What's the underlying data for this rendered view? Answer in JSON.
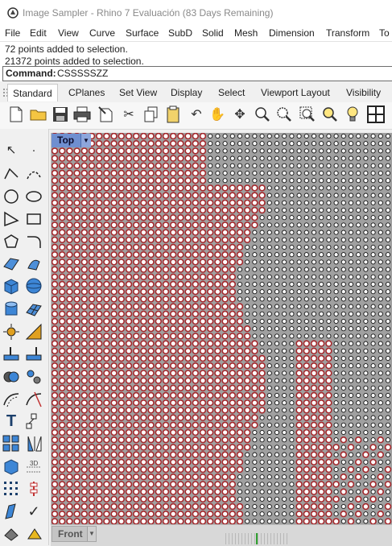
{
  "window": {
    "title": "Image Sampler - Rhino 7 Evaluación (83 Days Remaining)"
  },
  "menubar": {
    "items": [
      "File",
      "Edit",
      "View",
      "Curve",
      "Surface",
      "SubD",
      "Solid",
      "Mesh",
      "Dimension",
      "Transform",
      "To"
    ]
  },
  "history": {
    "lines": [
      "72 points added to selection.",
      "21372 points added to selection."
    ]
  },
  "command": {
    "label": "Command:",
    "value": "CSSSSSZZ"
  },
  "tabs": [
    "Standard",
    "CPlanes",
    "Set View",
    "Display",
    "Select",
    "Viewport Layout",
    "Visibility"
  ],
  "active_tab": "Standard",
  "toolbar_icons": [
    "new-file-icon",
    "open-folder-icon",
    "save-icon",
    "print-icon",
    "import-icon",
    "cut-icon",
    "copy-icon",
    "paste-icon",
    "undo-icon",
    "pan-hand-icon",
    "rotate-view-icon",
    "zoom-icon",
    "zoom-window-icon",
    "zoom-extents-icon",
    "zoom-selected-icon",
    "light-bulb-icon",
    "grid-icon"
  ],
  "left_tool_icons": [
    "select-arrow-icon",
    "point-icon",
    "polyline-icon",
    "curve-points-icon",
    "circle-icon",
    "ellipse-icon",
    "arc-icon",
    "rectangle-icon",
    "polygon-icon",
    "fillet-curve-icon",
    "surface-corner-icon",
    "revolve-surface-icon",
    "box-icon",
    "sphere-icon",
    "cylinder-icon",
    "mesh-surface-icon",
    "explode-icon",
    "boolean-icon",
    "extrude-icon",
    "split-icon",
    "group-icon",
    "ungroup-icon",
    "offset-curve-icon",
    "trim-icon",
    "text-icon",
    "dimension-icon",
    "array-icon",
    "mirror-icon",
    "solid-box-icon",
    "scale-icon",
    "point-grid-icon",
    "point-edit-icon",
    "cut-plane-icon",
    "check-icon",
    "render-icon",
    "material-icon"
  ],
  "viewport": {
    "name": "Top",
    "bottom_tab": "Front"
  },
  "colors": {
    "viewport_bg": "#a0a0a0",
    "point_fill": "#ffffff",
    "point_stroke": "#111111",
    "selected_stroke": "#a4282c",
    "viewport_label_bg": "#6f8fd0"
  }
}
